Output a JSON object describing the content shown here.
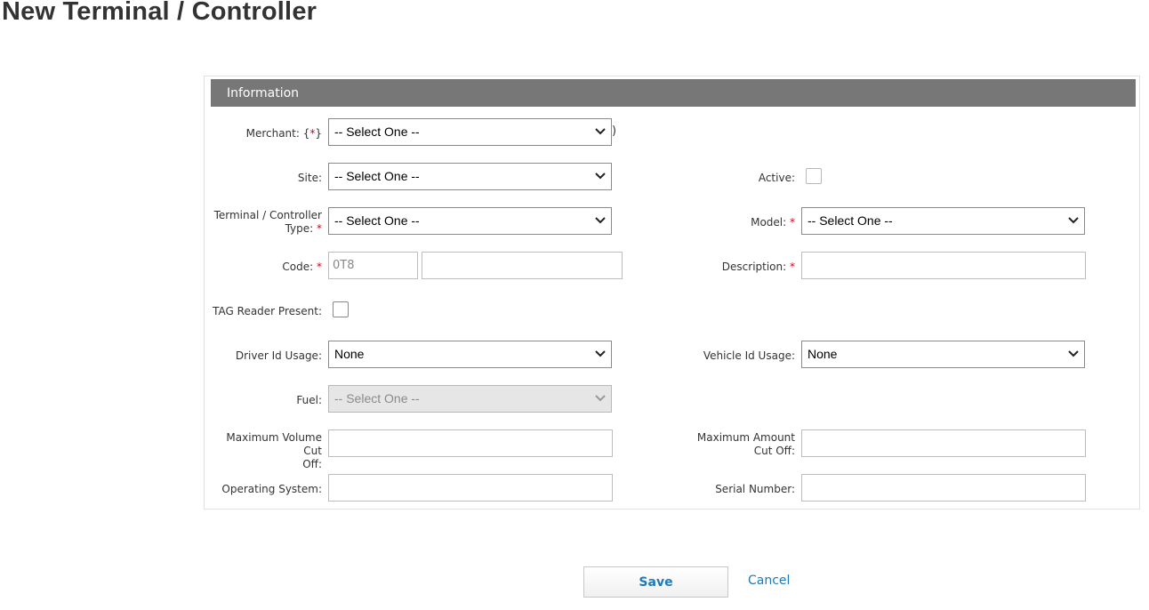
{
  "page": {
    "title": "New Terminal / Controller"
  },
  "section": {
    "title": "Information"
  },
  "fields": {
    "merchant": {
      "label": "Merchant: {",
      "req": "*",
      "label_end": "}",
      "value": "-- Select One --",
      "trail": ")"
    },
    "site": {
      "label": "Site:",
      "value": "-- Select One --"
    },
    "active": {
      "label": "Active:",
      "checked": false
    },
    "terminal_type": {
      "label_line1": "Terminal / Controller",
      "label_line2": "Type:",
      "req": "*",
      "value": "-- Select One --"
    },
    "model": {
      "label": "Model:",
      "req": "*",
      "value": "-- Select One --"
    },
    "code": {
      "label": "Code:",
      "req": "*",
      "prefix": "0T8",
      "value": ""
    },
    "description": {
      "label": "Description:",
      "req": "*",
      "value": ""
    },
    "tag_reader": {
      "label": "TAG Reader Present:",
      "checked": false
    },
    "driver_id_usage": {
      "label": "Driver Id Usage:",
      "value": "None"
    },
    "vehicle_id_usage": {
      "label": "Vehicle Id Usage:",
      "value": "None"
    },
    "fuel": {
      "label": "Fuel:",
      "value": "-- Select One --",
      "disabled": true
    },
    "max_volume": {
      "label_line1": "Maximum Volume Cut",
      "label_line2": "Off:",
      "value": ""
    },
    "max_amount": {
      "label_line1": "Maximum Amount",
      "label_line2": "Cut Off:",
      "value": ""
    },
    "operating_system": {
      "label": "Operating System:",
      "value": ""
    },
    "serial_number": {
      "label": "Serial Number:",
      "value": ""
    }
  },
  "actions": {
    "save_label": "Save",
    "cancel_label": "Cancel"
  },
  "colors": {
    "header_bg": "#777777",
    "link": "#1f7ab8",
    "required": "#d9001b"
  }
}
